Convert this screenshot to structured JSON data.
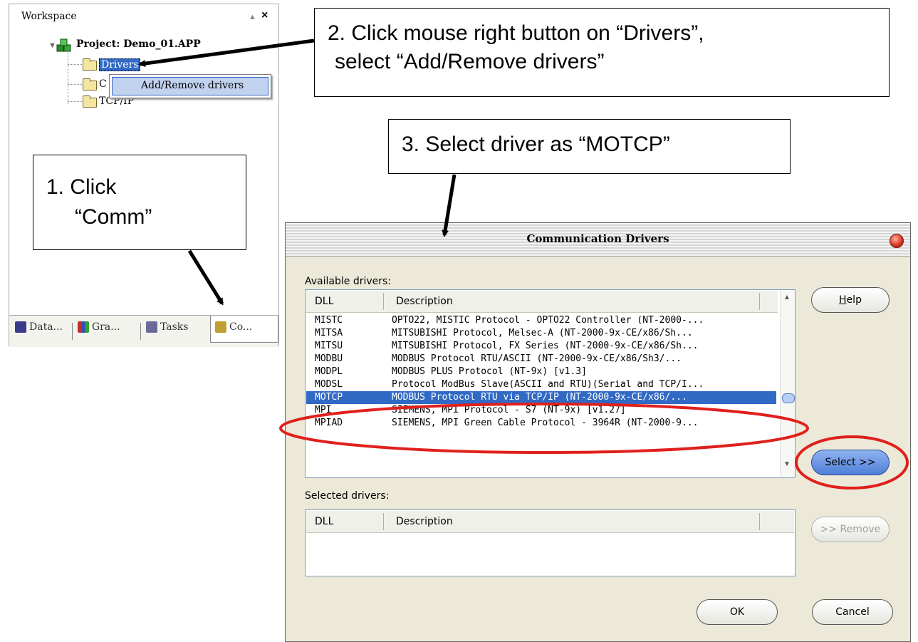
{
  "workspace": {
    "title": "Workspace",
    "pin_glyph": "▲",
    "close_glyph": "×",
    "project_label": "Project: Demo_01.APP",
    "tree": {
      "drivers": "Drivers",
      "comm": "C",
      "tcpip": "TCP/IP"
    },
    "context_menu": {
      "item": "Add/Remove drivers"
    },
    "tabs": [
      {
        "label": "Data...",
        "icon": "database-icon"
      },
      {
        "label": "Gra...",
        "icon": "graphics-icon"
      },
      {
        "label": "Tasks",
        "icon": "tasks-icon"
      },
      {
        "label": "Co...",
        "icon": "comm-icon"
      }
    ]
  },
  "callouts": {
    "step1": {
      "line1": "1.  Click",
      "line2": "“Comm”"
    },
    "step2": {
      "line1": "2. Click mouse right button on “Drivers”,",
      "line2": "select “Add/Remove drivers”"
    },
    "step3": {
      "line1": "3. Select driver as “MOTCP”"
    }
  },
  "dialog": {
    "title": "Communication Drivers",
    "available_label": "Available drivers:",
    "selected_label": "Selected drivers:",
    "columns": {
      "dll": "DLL",
      "description": "Description"
    },
    "available_rows": [
      {
        "dll": "MISTC",
        "description": "OPTO22, MISTIC Protocol - OPTO22 Controller (NT-2000-..."
      },
      {
        "dll": "MITSA",
        "description": "MITSUBISHI Protocol, Melsec-A  (NT-2000-9x-CE/x86/Sh..."
      },
      {
        "dll": "MITSU",
        "description": "MITSUBISHI Protocol, FX Series  (NT-2000-9x-CE/x86/Sh..."
      },
      {
        "dll": "MODBU",
        "description": "MODBUS Protocol RTU/ASCII (NT-2000-9x-CE/x86/Sh3/..."
      },
      {
        "dll": "MODPL",
        "description": "MODBUS PLUS Protocol (NT-9x) [v1.3]"
      },
      {
        "dll": "MODSL",
        "description": "Protocol ModBus Slave(ASCII and RTU)(Serial and TCP/I..."
      },
      {
        "dll": "MOTCP",
        "description": "MODBUS Protocol RTU via TCP/IP (NT-2000-9x-CE/x86/...",
        "selected": true
      },
      {
        "dll": "MPI",
        "description": "SIEMENS, MPI Protocol - S7 (NT-9x) [v1.27]"
      },
      {
        "dll": "MPIAD",
        "description": "SIEMENS, MPI Green Cable Protocol - 3964R (NT-2000-9..."
      }
    ],
    "buttons": {
      "help_prefix": "",
      "help_accel": "H",
      "help_rest": "elp",
      "select": "Select >>",
      "remove": ">> Remove",
      "ok": "OK",
      "cancel": "Cancel"
    }
  },
  "colors": {
    "selection": "#316ac5",
    "highlight_ellipse": "#e0201c",
    "dialog_bg": "#ece9d8"
  }
}
